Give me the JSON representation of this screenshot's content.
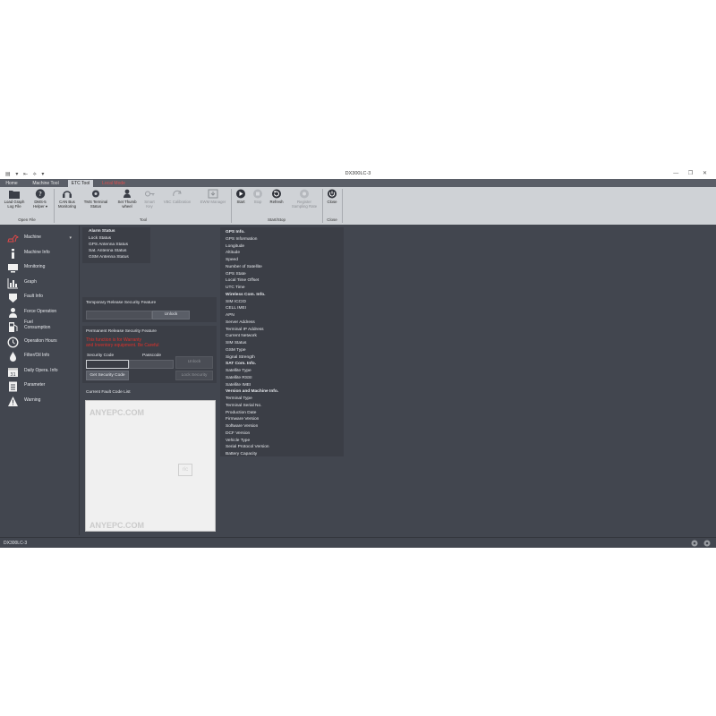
{
  "window": {
    "title": "DX300LC-3",
    "controls": [
      "—",
      "❐",
      "✕"
    ]
  },
  "quick_access": "▤ ▾ ⇤ ⟡ ▾",
  "tabs": [
    {
      "label": "Home",
      "active": false
    },
    {
      "label": "Machine Tool",
      "active": false
    },
    {
      "label": "ETC Tool",
      "active": true
    },
    {
      "label": "Local Mode",
      "active": false
    }
  ],
  "ribbon": {
    "buttons": {
      "load_graph": "Load Graph\nLog File",
      "dms_helper": "DMS-5\nHelper ▾",
      "can_bus": "CAN Bus\nMonitoring",
      "tms_terminal": "TMS Terminal\nStatus",
      "set_thumb": "Set Thumb\nwheel",
      "smart_key": "Smart\nKey",
      "vbc": "VBC Calibration",
      "ewm": "EWM Manager",
      "start": "Start",
      "stop": "Stop",
      "refresh": "Refresh",
      "register": "Register\nSampling Rate",
      "close": "Close"
    },
    "groups": {
      "open_file": "Open File",
      "tool": "Tool",
      "start_stop": "Start/Stop",
      "close": "Close"
    }
  },
  "sidebar": {
    "items": [
      {
        "label": "Machine",
        "icon": "excavator-icon"
      },
      {
        "label": "Machine Info",
        "icon": "info-icon"
      },
      {
        "label": "Monitoring",
        "icon": "monitor-icon"
      },
      {
        "label": "Graph",
        "icon": "graph-icon"
      },
      {
        "label": "Fault Info",
        "icon": "fault-icon"
      },
      {
        "label": "Force Operation",
        "icon": "person-icon"
      },
      {
        "label": "Fuel\nConsumption",
        "icon": "fuel-icon"
      },
      {
        "label": "Operation Hours",
        "icon": "clock-icon"
      },
      {
        "label": "Filter/Oil Info",
        "icon": "oil-drop-icon"
      },
      {
        "label": "Daily Opera. Info",
        "icon": "calendar-icon"
      },
      {
        "label": "Parameter",
        "icon": "clipboard-icon"
      },
      {
        "label": "Warning",
        "icon": "warning-icon"
      }
    ]
  },
  "alarm": {
    "title": "Alarm Status",
    "items": [
      "Lock Status",
      "GPS Antenna Status",
      "Sat. Antenna Status",
      "GSM Antenna Status"
    ]
  },
  "temp_release": {
    "title": "Temporary Release Security Feature",
    "unlock": "Unlock"
  },
  "perm_release": {
    "title": "Permanent Release Security Feature",
    "warning": "This function is for Warranty\nand Inventory equipment. Be Careful",
    "security_code": "Security Code",
    "passcode": "Passcode",
    "get_code": "Get Security Code",
    "unlock": "Unlock",
    "lock": "Lock Security"
  },
  "fault": {
    "title": "Current Fault Code List"
  },
  "info_list": [
    {
      "label": "GPS Info.",
      "header": true
    },
    {
      "label": "GPS Information"
    },
    {
      "label": "Longitude"
    },
    {
      "label": "Altitude"
    },
    {
      "label": "Speed"
    },
    {
      "label": "Number of Satellite"
    },
    {
      "label": "GPS State"
    },
    {
      "label": "Local Time Offset"
    },
    {
      "label": "UTC Time"
    },
    {
      "label": "Wireless Com. Info.",
      "header": true
    },
    {
      "label": "SIM ICCID"
    },
    {
      "label": "CELL IMEI"
    },
    {
      "label": "APN"
    },
    {
      "label": "Server Address"
    },
    {
      "label": "Terminal IP Address"
    },
    {
      "label": "Current Network"
    },
    {
      "label": "SIM Status"
    },
    {
      "label": "GSM Type"
    },
    {
      "label": "Signal Strength"
    },
    {
      "label": "SAT Com. Info.",
      "header": true
    },
    {
      "label": "Satellite Type"
    },
    {
      "label": "Satellite RSSI"
    },
    {
      "label": "Satellite IMEI"
    },
    {
      "label": "Version and Machine Info.",
      "header": true
    },
    {
      "label": "Terminal Type"
    },
    {
      "label": "Terminal Serial No."
    },
    {
      "label": "Production Date"
    },
    {
      "label": "Firmware Version"
    },
    {
      "label": "Software Version"
    },
    {
      "label": "DCF Version"
    },
    {
      "label": "Vehicle Type"
    },
    {
      "label": "Serial Protocol Version"
    },
    {
      "label": "Battery Capacity"
    }
  ],
  "watermark": "ANYEPC.COM",
  "status": {
    "text": "DX300LC-3"
  },
  "colors": {
    "background": "#42464f",
    "ribbon": "#cfd2d6",
    "warning": "#e0312b",
    "context_tab": "#e05050"
  }
}
